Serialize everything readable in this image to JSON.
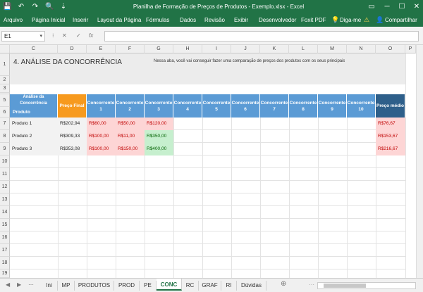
{
  "window": {
    "title": "Planilha de Formação de Preços de Produtos - Exemplo.xlsx - Excel"
  },
  "quick_access": {
    "save_icon": "💾",
    "undo_icon": "↶",
    "redo_icon": "↷",
    "preview_icon": "🔍",
    "more_icon": "⇣"
  },
  "window_controls": {
    "restore_icon": "▭",
    "minimize_icon": "─",
    "maximize_icon": "☐",
    "close_icon": "✕"
  },
  "ribbon": {
    "tabs": [
      "Arquivo",
      "Página Inicial",
      "Inserir",
      "Layout da Página",
      "Fórmulas",
      "Dados",
      "Revisão",
      "Exibir",
      "Desenvolvedor",
      "Foxit PDF"
    ],
    "tellme_label": "Diga-me",
    "tellme_icon": "💡",
    "warning_icon": "⚠",
    "share_label": "Compartilhar",
    "share_icon": "👤"
  },
  "formula_bar": {
    "name_box": "E1",
    "name_box_dropdown": "▾",
    "sep_icon": "⁝",
    "cancel_icon": "✕",
    "enter_icon": "✓",
    "fx_label": "fx",
    "formula": ""
  },
  "columns": [
    "C",
    "D",
    "E",
    "F",
    "G",
    "H",
    "I",
    "J",
    "K",
    "L",
    "M",
    "N",
    "O",
    "P"
  ],
  "rows": [
    "1",
    "2",
    "3",
    "4",
    "5",
    "6",
    "7",
    "8",
    "9",
    "10",
    "11",
    "12",
    "13",
    "14",
    "15",
    "16",
    "17",
    "18",
    "19"
  ],
  "sheet": {
    "title": "4. ANÁLISE DA CONCORRÊNCIA",
    "description": "Nessa aba, você vai conseguir fazer uma comparação de preços dos produtos com os seus principais",
    "analise_header": "Análise da Concorrência",
    "produto_header": "Produto",
    "preco_final_header": "Preço Final",
    "competitors": [
      "Concorrente 1",
      "Concorrente 2",
      "Concorrente 3",
      "Concorrente 4",
      "Concorrente 5",
      "Concorrente 6",
      "Concorrente 7",
      "Concorrente 8",
      "Concorrente 9",
      "Concorrente 10"
    ],
    "preco_medio_header": "Preço médio",
    "products": [
      {
        "name": "Produto 1",
        "price": "R$202,94",
        "c1": "R$60,00",
        "c2": "R$50,00",
        "c3": "R$120,00",
        "avg": "R$76,67"
      },
      {
        "name": "Produto 2",
        "price": "R$309,33",
        "c1": "R$100,00",
        "c2": "R$11,00",
        "c3": "R$350,00",
        "avg": "R$153,67"
      },
      {
        "name": "Produto 3",
        "price": "R$353,08",
        "c1": "R$100,00",
        "c2": "R$150,00",
        "c3": "R$400,00",
        "avg": "R$216,67"
      }
    ]
  },
  "sheet_tabs": [
    "Ini",
    "MP",
    "PRODUTOS",
    "PROD",
    "PE",
    "CONC",
    "RC",
    "GRAF",
    "RI",
    "Dúvidas"
  ],
  "active_tab": "CONC",
  "tab_nav": {
    "prev_icon": "◀",
    "next_icon": "▶",
    "more_icon": "⋯",
    "add_icon": "⊕"
  },
  "colors": {
    "excel_green": "#217346",
    "header_blue": "#5b9bd5",
    "header_dark_blue": "#2e5f8a",
    "header_orange": "#f79a1e",
    "price_red_fill": "#fdd5d5",
    "price_red_text": "#c00000",
    "price_green_fill": "#c6efce",
    "price_green_text": "#006100"
  }
}
